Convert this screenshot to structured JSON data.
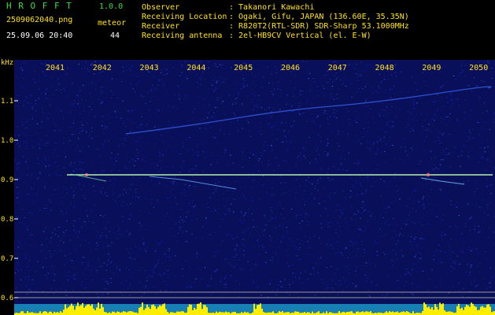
{
  "app": {
    "name_letters": "H R O F F T",
    "version": "1.0.0"
  },
  "file": {
    "name": "2509062040.png",
    "datetime": "25.09.06 20:40"
  },
  "counter": {
    "label": "meteor",
    "value": "44"
  },
  "info": {
    "observer_label": "Observer",
    "observer_value": ": Takanori Kawachi",
    "location_label": "Receiving Location",
    "location_value": ": Ogaki, Gifu, JAPAN (136.60E, 35.35N)",
    "receiver_label": "Receiver",
    "receiver_value": ": R820T2(RTL-SDR) SDR-Sharp 53.1000MHz",
    "antenna_label": "Receiving antenna",
    "antenna_value": ": 2el-HB9CV Vertical (el. E-W)"
  },
  "chart_data": {
    "type": "heatmap",
    "ylabel": "kHz",
    "x_ticks": [
      "2041",
      "2042",
      "2043",
      "2044",
      "2045",
      "2046",
      "2047",
      "2048",
      "2049",
      "2050"
    ],
    "y_ticks": [
      "1.1",
      "1.0",
      "0.9",
      "0.8",
      "0.7",
      "0.6"
    ],
    "carrier_khz": 0.91
  },
  "colors": {
    "background": "#0a0f5a",
    "carrier": "#b8f0b0",
    "tick_text": "#ffe21a",
    "header_green": "#3fdc3f",
    "meter_yellow": "#ffee00",
    "meter_cyan": "#22ddff"
  }
}
